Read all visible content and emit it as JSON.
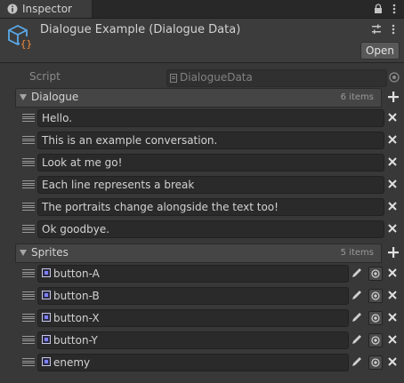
{
  "tab": {
    "label": "Inspector"
  },
  "header": {
    "title": "Dialogue Example (Dialogue Data)",
    "open_label": "Open"
  },
  "script_field": {
    "label": "Script",
    "value": "DialogueData"
  },
  "dialogue": {
    "title": "Dialogue",
    "count": "6 items",
    "items": [
      "Hello.",
      "This is an example conversation.",
      "Look at me go!",
      "Each line represents a break",
      "The portraits change alongside the text too!",
      "Ok goodbye."
    ]
  },
  "sprites": {
    "title": "Sprites",
    "count": "5 items",
    "items": [
      "button-A",
      "button-B",
      "button-X",
      "button-Y",
      "enemy"
    ]
  },
  "colors": {
    "panel": "#383838",
    "field": "#2a2a2a",
    "header": "#3c3c3c",
    "accent": "#4b9fe6"
  }
}
